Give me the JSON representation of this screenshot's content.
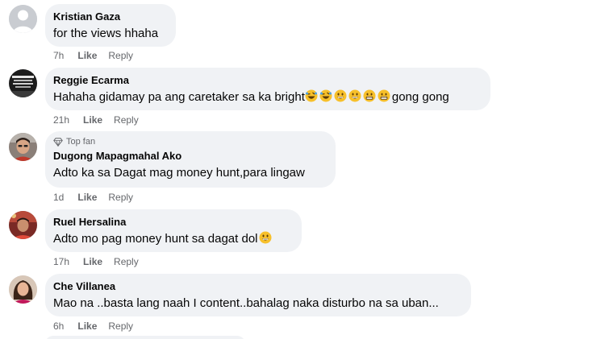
{
  "comments": [
    {
      "author": "Kristian Gaza",
      "text": "for the views hhaha",
      "time": "7h",
      "like_label": "Like",
      "reply_label": "Reply",
      "avatar": "default-avatar"
    },
    {
      "author": "Reggie Ecarma",
      "text_before": "Hahaha gidamay pa ang caretaker sa ka bright",
      "emojis": [
        "rolling-laughing",
        "rolling-laughing",
        "grinning",
        "grinning",
        "grimacing",
        "grimacing"
      ],
      "text_after": "gong gong",
      "time": "21h",
      "like_label": "Like",
      "reply_label": "Reply",
      "avatar": "dark-photo-avatar"
    },
    {
      "badge": "Top fan",
      "badge_icon": "diamond-icon",
      "author": "Dugong Mapagmahal Ako",
      "text": "Adto ka sa Dagat mag money hunt,para lingaw",
      "time": "1d",
      "like_label": "Like",
      "reply_label": "Reply",
      "avatar": "man-photo-avatar"
    },
    {
      "author": "Ruel Hersalina",
      "text": "Adto mo pag money hunt sa dagat dol",
      "emojis": [
        "grinning"
      ],
      "time": "17h",
      "like_label": "Like",
      "reply_label": "Reply",
      "avatar": "red-photo-avatar"
    },
    {
      "author": "Che Villanea",
      "text": "Mao na ..basta lang naah I content..bahalag naka disturbo na sa uban...",
      "time": "6h",
      "like_label": "Like",
      "reply_label": "Reply",
      "avatar": "woman-photo-avatar"
    }
  ],
  "colors": {
    "bubble": "#f0f2f5",
    "meta_text": "#65676b",
    "text": "#050505"
  }
}
